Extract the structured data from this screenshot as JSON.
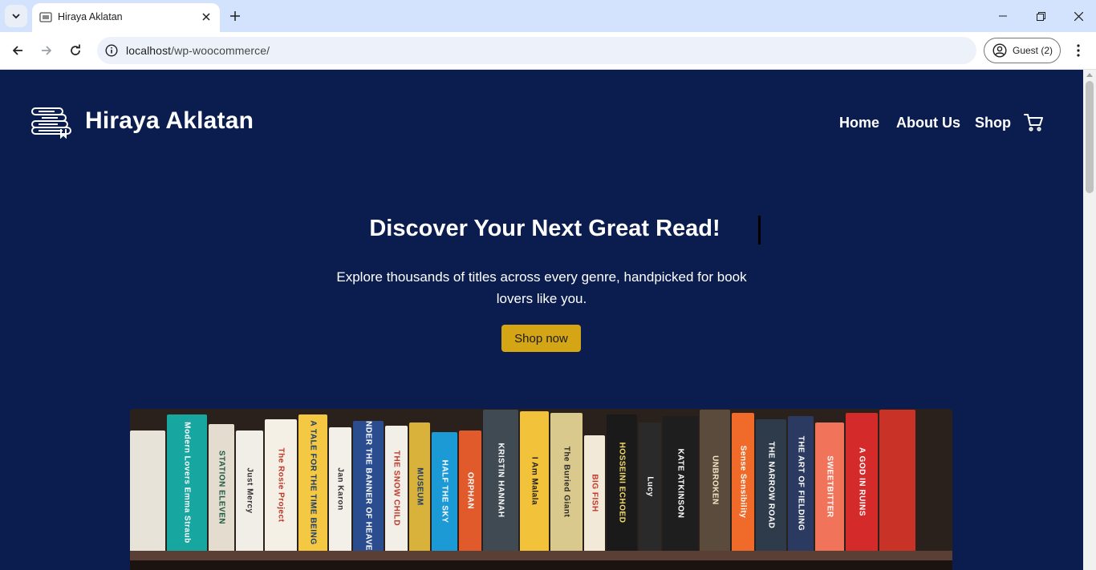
{
  "browser": {
    "tab_title": "Hiraya Aklatan",
    "url_host": "localhost",
    "url_path": "/wp-woocommerce/",
    "profile_label": "Guest (2)"
  },
  "site": {
    "title": "Hiraya Aklatan",
    "nav": [
      "Home",
      "About Us",
      "Shop"
    ]
  },
  "hero": {
    "title": "Discover Your Next Great Read!",
    "subtitle": "Explore thousands of titles across every genre, handpicked for book lovers like you.",
    "cta": "Shop now"
  },
  "books": [
    {
      "title": "",
      "color": "#e8e3d8",
      "text_color": "#333333"
    },
    {
      "title": "Modern Lovers  Emma Straub",
      "color": "#17a6a0",
      "text_color": "#ffffff"
    },
    {
      "title": "STATION ELEVEN",
      "color": "#e4dccf",
      "text_color": "#1e5a44"
    },
    {
      "title": "Just Mercy",
      "color": "#f1eee7",
      "text_color": "#333333"
    },
    {
      "title": "The Rosie Project",
      "color": "#f5f0e6",
      "text_color": "#c0392b"
    },
    {
      "title": "A TALE FOR THE TIME BEING",
      "color": "#f4c842",
      "text_color": "#1d3b6b"
    },
    {
      "title": "Jan Karon",
      "color": "#f3f0ea",
      "text_color": "#333333"
    },
    {
      "title": "UNDER THE BANNER OF HEAVEN",
      "color": "#2a4d8f",
      "text_color": "#ffffff"
    },
    {
      "title": "THE SNOW CHILD",
      "color": "#f2efe8",
      "text_color": "#c0392b"
    },
    {
      "title": "MUSEUM",
      "color": "#d8b23a",
      "text_color": "#1d3b6b"
    },
    {
      "title": "HALF THE SKY",
      "color": "#1c9ad6",
      "text_color": "#ffffff"
    },
    {
      "title": "ORPHAN",
      "color": "#e05a2b",
      "text_color": "#ffffff"
    },
    {
      "title": "KRISTIN HANNAH",
      "color": "#3f4a53",
      "text_color": "#ffffff"
    },
    {
      "title": "I Am Malala",
      "color": "#f2c23b",
      "text_color": "#1d1d1d"
    },
    {
      "title": "The Buried Giant",
      "color": "#d9c98c",
      "text_color": "#2b2b2b"
    },
    {
      "title": "BIG FISH",
      "color": "#f3e9d8",
      "text_color": "#c0392b"
    },
    {
      "title": "HOSSEINI ECHOED",
      "color": "#1a1a1a",
      "text_color": "#f2d96b"
    },
    {
      "title": "Lucy",
      "color": "#2a2a2a",
      "text_color": "#ffffff"
    },
    {
      "title": "KATE ATKINSON",
      "color": "#1e1e1e",
      "text_color": "#ffffff"
    },
    {
      "title": "UNBROKEN",
      "color": "#5a4b3d",
      "text_color": "#f3e6c4"
    },
    {
      "title": "Sense Sensibility",
      "color": "#f06a2a",
      "text_color": "#ffffff"
    },
    {
      "title": "THE NARROW ROAD",
      "color": "#2d3b4a",
      "text_color": "#ffffff"
    },
    {
      "title": "THE ART OF FIELDING",
      "color": "#2a3a60",
      "text_color": "#ffffff"
    },
    {
      "title": "SWEETBITTER",
      "color": "#f0735a",
      "text_color": "#ffffff"
    },
    {
      "title": "A GOD IN RUINS",
      "color": "#d42a2a",
      "text_color": "#ffffff"
    },
    {
      "title": "",
      "color": "#c93226",
      "text_color": "#ffffff"
    }
  ],
  "colors": {
    "page_bg": "#0b1d4e",
    "cta_bg": "#d4a515"
  }
}
